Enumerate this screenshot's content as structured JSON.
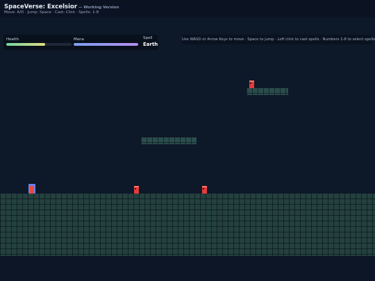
{
  "header": {
    "title": "SpaceVerse: Excelsior",
    "version": "— Working Version",
    "controls": "Move: A/D · Jump: Space · Cast: Click · Spells: 1-8"
  },
  "hud": {
    "health_label": "Health",
    "health_fraction": 0.6,
    "mana_label": "Mana",
    "mana_fraction": 1.0,
    "spell_label": "Spell",
    "spell_value": "Earth"
  },
  "hint": "Use WASD or Arrow Keys to move · Space to jump · Left click to cast spells · Numbers 1-8 to select spells",
  "colors": {
    "background": "#0d1828",
    "tile": "#2b4c4c",
    "enemy": "#e43a3a",
    "player": "#6b7ff0"
  }
}
